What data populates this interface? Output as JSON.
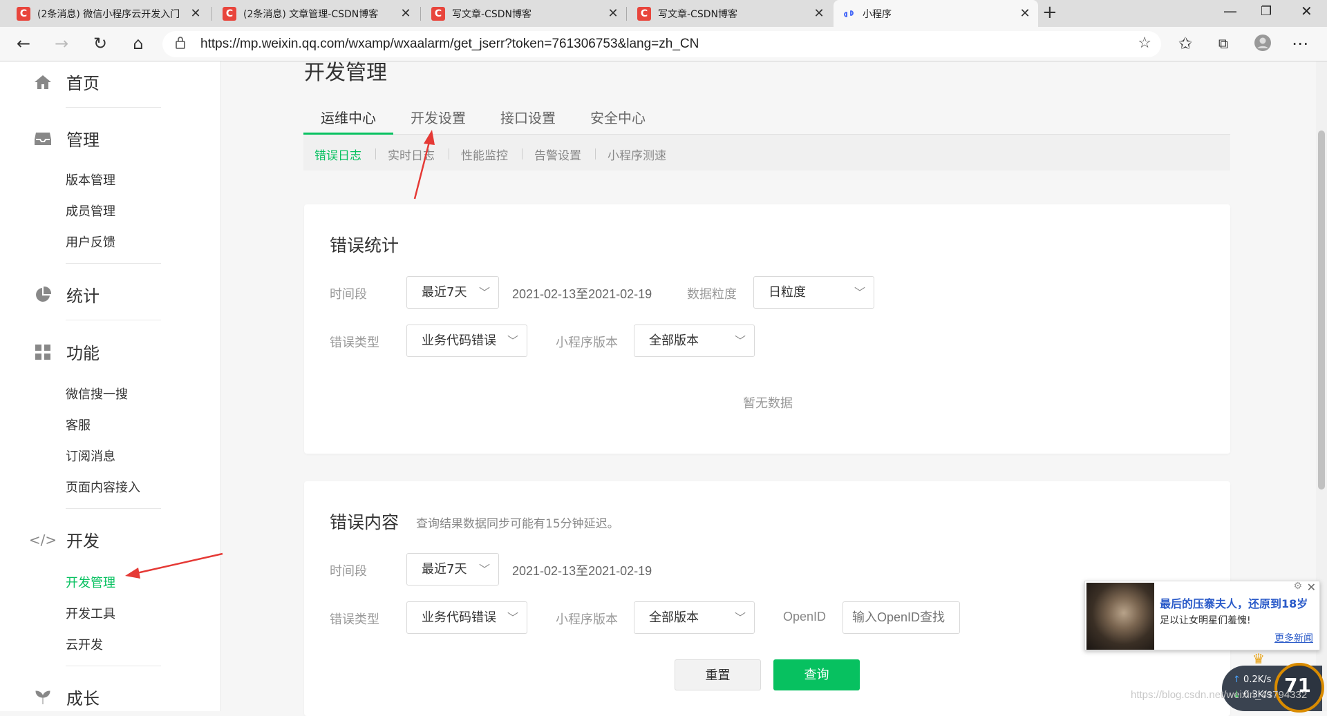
{
  "browser": {
    "tabs": [
      {
        "title": "(2条消息) 微信小程序云开发入门",
        "icon": "csdn-icon"
      },
      {
        "title": "(2条消息) 文章管理-CSDN博客",
        "icon": "csdn-icon"
      },
      {
        "title": "写文章-CSDN博客",
        "icon": "csdn-icon"
      },
      {
        "title": "写文章-CSDN博客",
        "icon": "csdn-icon"
      },
      {
        "title": "小程序",
        "icon": "miniprogram-icon"
      }
    ],
    "csdn_icon_glyph": "C",
    "close_glyph": "✕",
    "new_tab_glyph": "+",
    "url": "https://mp.weixin.qq.com/wxamp/wxaalarm/get_jserr?token=761306753&lang=zh_CN"
  },
  "sidebar": {
    "home": "首页",
    "manage": "管理",
    "manage_items": [
      "版本管理",
      "成员管理",
      "用户反馈"
    ],
    "stats": "统计",
    "features": "功能",
    "feature_items": [
      "微信搜一搜",
      "客服",
      "订阅消息",
      "页面内容接入"
    ],
    "dev": "开发",
    "dev_items": [
      "开发管理",
      "开发工具",
      "云开发"
    ],
    "growth": "成长"
  },
  "main": {
    "title": "开发管理",
    "tabs": [
      "运维中心",
      "开发设置",
      "接口设置",
      "安全中心"
    ],
    "subtabs": [
      "错误日志",
      "实时日志",
      "性能监控",
      "告警设置",
      "小程序测速"
    ]
  },
  "error_stats": {
    "title": "错误统计",
    "period_label": "时间段",
    "period_value": "最近7天",
    "date_range": "2021-02-13至2021-02-19",
    "granularity_label": "数据粒度",
    "granularity_value": "日粒度",
    "type_label": "错误类型",
    "type_value": "业务代码错误",
    "version_label": "小程序版本",
    "version_value": "全部版本",
    "empty": "暂无数据"
  },
  "error_content": {
    "title": "错误内容",
    "note": "查询结果数据同步可能有15分钟延迟。",
    "period_label": "时间段",
    "period_value": "最近7天",
    "date_range": "2021-02-13至2021-02-19",
    "type_label": "错误类型",
    "type_value": "业务代码错误",
    "version_label": "小程序版本",
    "version_value": "全部版本",
    "openid_label": "OpenID",
    "openid_placeholder": "输入OpenID查找",
    "reset": "重置",
    "query": "查询"
  },
  "popup": {
    "headline": "最后的压寨夫人，还原到18岁",
    "desc": "足以让女明星们羞愧!",
    "more": "更多新闻"
  },
  "netmon": {
    "up": "0.2K/s",
    "down": "0.3K/s",
    "percent": "71"
  },
  "watermark": "https://blog.csdn.net/weixin_43794332",
  "colors": {
    "accent": "#07c160",
    "arrow": "#e53935",
    "link": "#2b5bc9"
  }
}
